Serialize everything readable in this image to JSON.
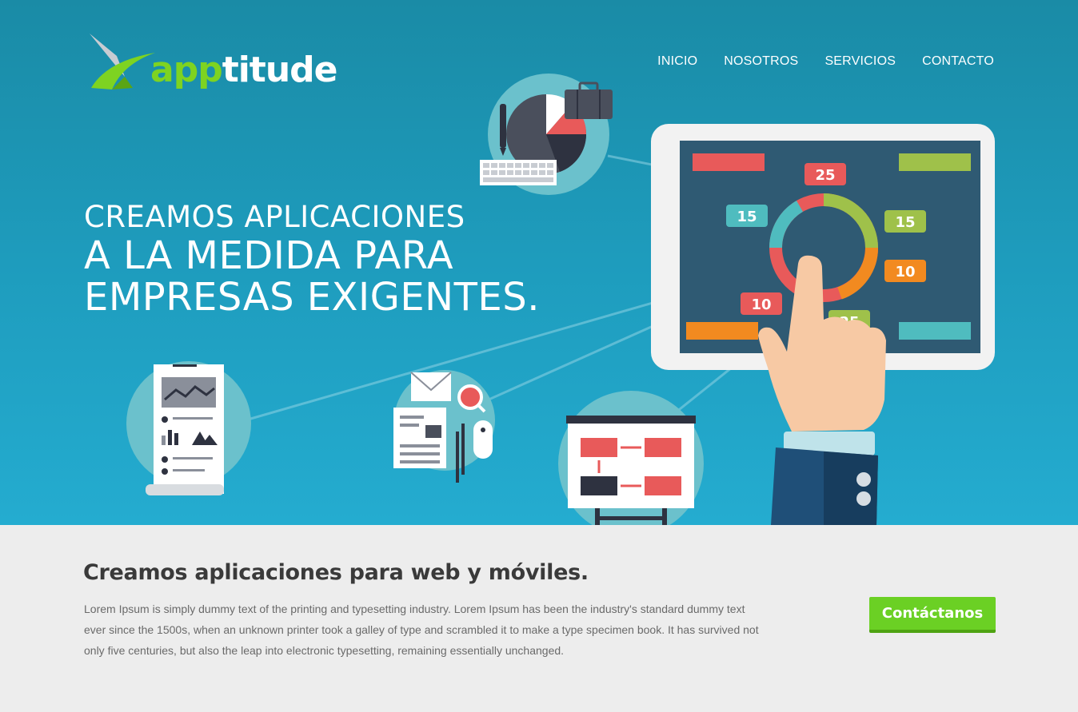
{
  "brand": {
    "name_part1": "app",
    "name_part2": "titude"
  },
  "nav": {
    "items": [
      "INICIO",
      "NOSOTROS",
      "SERVICIOS",
      "CONTACTO"
    ]
  },
  "hero": {
    "line1": "CREAMOS APLICACIONES",
    "line2": "A LA MEDIDA PARA",
    "line3": "EMPRESAS EXIGENTES.",
    "tablet_values": [
      "25",
      "15",
      "15",
      "10",
      "10",
      "25"
    ]
  },
  "section": {
    "title": "Creamos aplicaciones para web y móviles.",
    "body": "Lorem Ipsum is simply dummy text of the printing and typesetting industry. Lorem Ipsum has been the industry's standard dummy text ever since the 1500s, when an unknown printer took a galley of type and scrambled it to make a type specimen book. It has survived not only five centuries, but also the leap into electronic typesetting, remaining essentially unchanged.",
    "cta_label": "Contáctanos"
  },
  "colors": {
    "hero_top": "#1a8ba6",
    "hero_bottom": "#24acd0",
    "accent_green": "#6bd024",
    "section_bg": "#ededed"
  }
}
